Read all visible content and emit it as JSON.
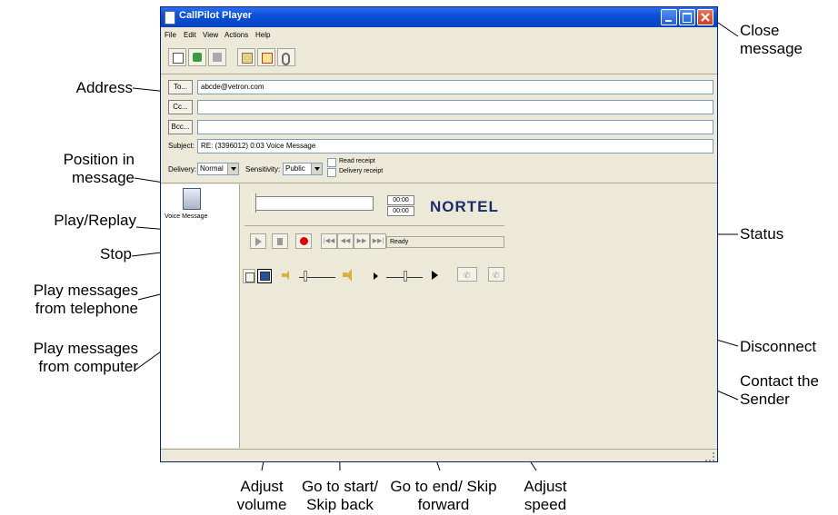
{
  "window": {
    "title": "CallPilot Player",
    "menu": [
      "File",
      "Edit",
      "View",
      "Actions",
      "Help"
    ]
  },
  "address": {
    "to_label": "To...",
    "to_value": "abcde@vetron.com",
    "cc_label": "Cc...",
    "cc_value": "",
    "bcc_label": "Bcc...",
    "bcc_value": "",
    "subject_label": "Subject:",
    "subject_value": "RE: (3396012) 0:03 Voice Message"
  },
  "options": {
    "delivery_label": "Delivery:",
    "delivery_value": "Normal",
    "sensitivity_label": "Sensitivity:",
    "sensitivity_value": "Public",
    "read_receipt_label": "Read receipt",
    "delivery_receipt_label": "Delivery receipt"
  },
  "message": {
    "item_label": "Voice Message"
  },
  "player": {
    "position_time": "00:00",
    "length_time": "00:00",
    "status_text": "Ready",
    "brand": "NORTEL",
    "colors": {
      "record": "#e00000",
      "brand": "#1a2d6b"
    }
  },
  "callouts": {
    "close": "Close message",
    "address": "Address",
    "position": "Position in message",
    "play": "Play/Replay",
    "stop": "Stop",
    "from_phone": "Play messages from telephone",
    "from_computer": "Play messages from computer",
    "status": "Status",
    "disconnect": "Disconnect",
    "contact": "Contact the Sender",
    "volume": "Adjust volume",
    "start": "Go to start/ Skip back",
    "end": "Go to end/ Skip forward",
    "speed": "Adjust speed"
  }
}
